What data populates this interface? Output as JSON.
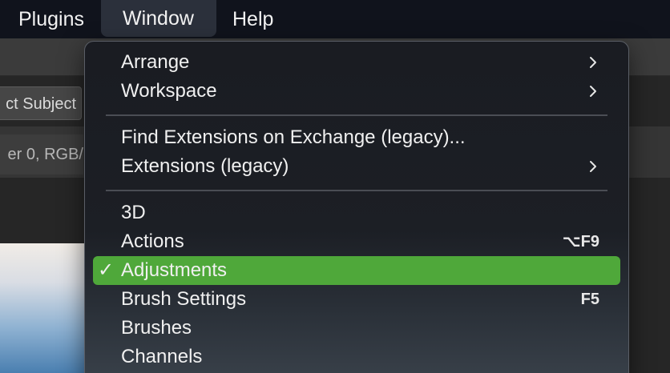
{
  "menubar": {
    "items": [
      {
        "label": "Plugins"
      },
      {
        "label": "Window"
      },
      {
        "label": "Help"
      }
    ]
  },
  "background_app": {
    "select_subject_label": "ct Subject",
    "document_tab_label": "er 0, RGB/"
  },
  "window_menu": {
    "items": [
      {
        "label": "Arrange",
        "submenu": true
      },
      {
        "label": "Workspace",
        "submenu": true
      },
      {
        "label": "Find Extensions on Exchange (legacy)..."
      },
      {
        "label": "Extensions (legacy)",
        "submenu": true
      },
      {
        "label": "3D"
      },
      {
        "label": "Actions",
        "shortcut": "⌥F9"
      },
      {
        "label": "Adjustments",
        "checked": true,
        "check_mark": "✓",
        "highlighted": true
      },
      {
        "label": "Brush Settings",
        "shortcut": "F5"
      },
      {
        "label": "Brushes"
      },
      {
        "label": "Channels"
      }
    ]
  },
  "colors": {
    "menubar_bg": "#10131c",
    "menu_highlight": "#4fa83a",
    "menu_text": "#f0f0f0"
  }
}
